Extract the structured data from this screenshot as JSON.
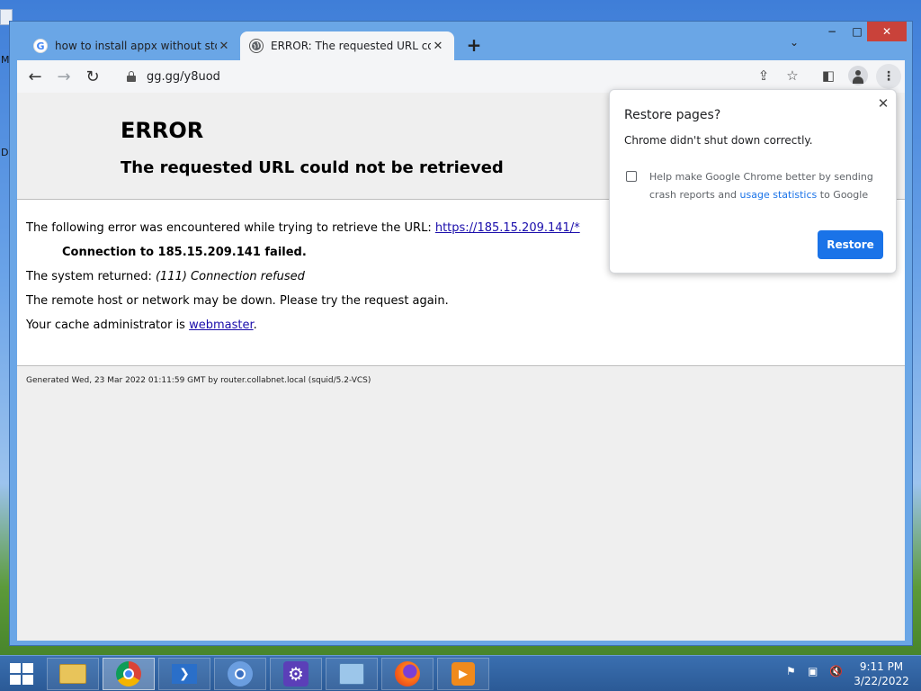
{
  "desktop": {
    "peek_letters": [
      "M",
      "D"
    ]
  },
  "tabs": [
    {
      "title": "how to install appx without store",
      "favicon": "G",
      "active": false
    },
    {
      "title": "ERROR: The requested URL could not be retrieved",
      "favicon": "globe",
      "active": true
    }
  ],
  "window_controls": {
    "minimize": "−",
    "maximize": "□",
    "close": "✕"
  },
  "toolbar": {
    "url": "gg.gg/y8uod"
  },
  "page": {
    "heading": "ERROR",
    "subheading": "The requested URL could not be retrieved",
    "line1_prefix": "The following error was encountered while trying to retrieve the URL: ",
    "line1_link": "https://185.15.209.141/*",
    "line2": "Connection to 185.15.209.141 failed.",
    "line3_prefix": "The system returned: ",
    "line3_italic": "(111) Connection refused",
    "line4": "The remote host or network may be down. Please try the request again.",
    "line5_prefix": "Your cache administrator is ",
    "line5_link": "webmaster",
    "line5_suffix": ".",
    "footer": "Generated Wed, 23 Mar 2022 01:11:59 GMT by router.collabnet.local (squid/5.2-VCS)"
  },
  "popup": {
    "title": "Restore pages?",
    "message": "Chrome didn't shut down correctly.",
    "checkbox_line1": "Help make Google Chrome better by sending",
    "checkbox_line2_prefix": "crash reports and ",
    "checkbox_line2_link": "usage statistics",
    "checkbox_line2_suffix": " to Google",
    "checkbox_checked": false,
    "restore_button": "Restore"
  },
  "taskbar": {
    "apps": [
      "file-explorer",
      "chrome",
      "powershell",
      "chromium",
      "settings",
      "control-panel",
      "firefox",
      "media-player"
    ],
    "clock_time": "9:11 PM",
    "clock_date": "3/22/2022"
  },
  "colors": {
    "accent": "#1a73e8",
    "close_button": "#c9423a",
    "taskbar": "#2b5a96"
  }
}
